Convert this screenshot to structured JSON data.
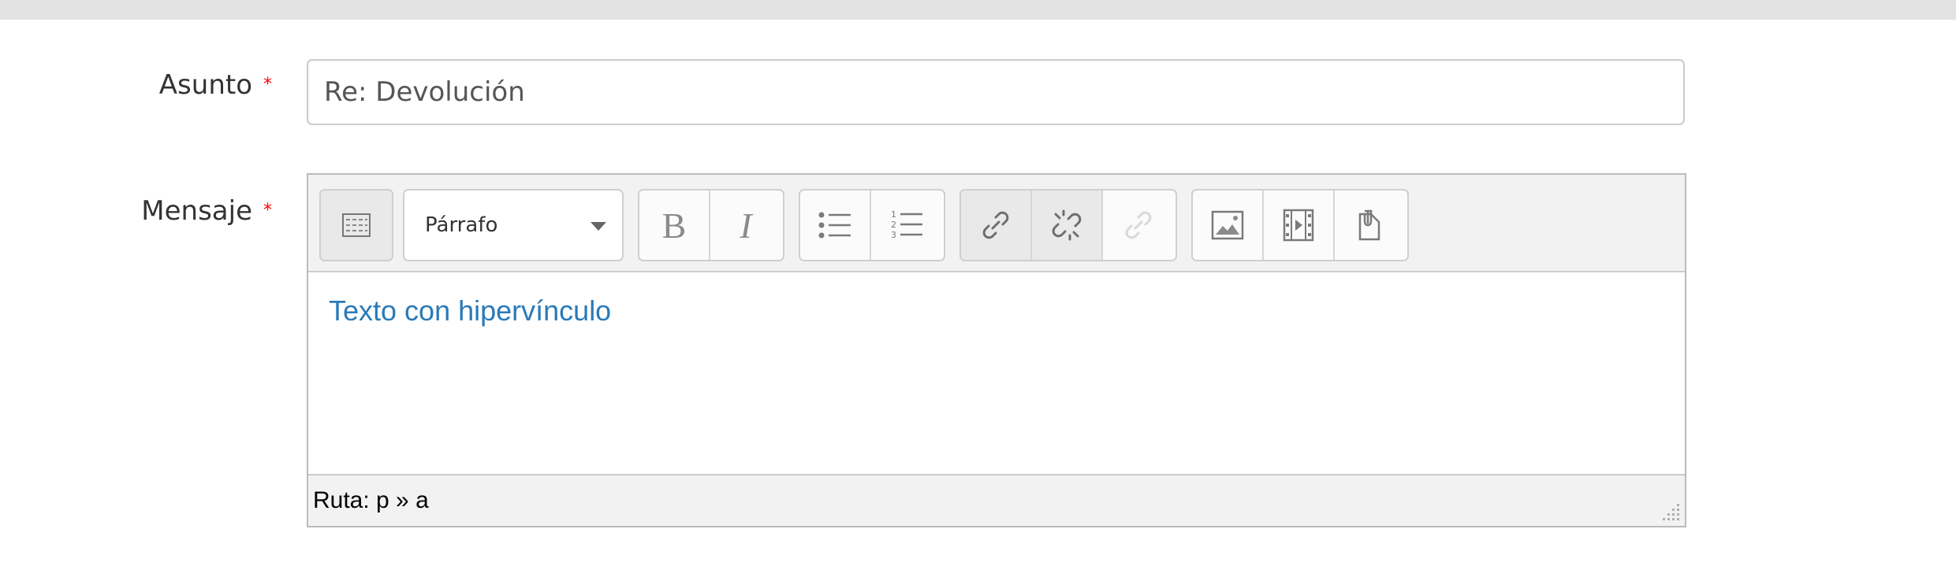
{
  "form": {
    "subject": {
      "label": "Asunto",
      "required_mark": "*",
      "value": "Re: Devolución"
    },
    "message": {
      "label": "Mensaje",
      "required_mark": "*"
    }
  },
  "editor": {
    "toolbar": {
      "toggle_icon": "toolbar-toggle-icon",
      "format_value": "Párrafo",
      "bold_icon": "bold-icon",
      "italic_icon": "italic-icon",
      "bullet_list_icon": "bullet-list-icon",
      "numbered_list_icon": "numbered-list-icon",
      "link_icon": "link-icon",
      "unlink_icon": "unlink-icon",
      "anchor_icon": "anchor-link-icon",
      "image_icon": "image-icon",
      "media_icon": "media-icon",
      "file_icon": "file-manager-icon"
    },
    "content_text": "Texto con hipervínculo",
    "path_text": "Ruta: p » a"
  },
  "colors": {
    "link": "#2a7ab8",
    "required": "#ff0000",
    "toolbar_bg": "#f2f2f2",
    "border": "#cccccc"
  }
}
